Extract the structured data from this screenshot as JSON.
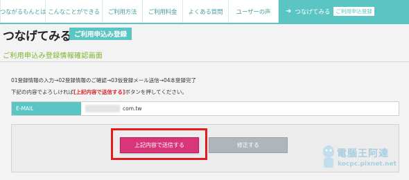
{
  "nav": {
    "items": [
      {
        "label": "つながるもんとは"
      },
      {
        "label": "こんなことができる"
      },
      {
        "label": "ご利用方法"
      },
      {
        "label": "ご利用料金"
      },
      {
        "label": "よくある質問"
      },
      {
        "label": "ユーザーの声"
      }
    ],
    "active": {
      "label": "つなげてみる",
      "badge": "ご利用申込登録"
    }
  },
  "page": {
    "title": "つなげてみる",
    "badge": "ご利用申込み登録",
    "subtitle": "ご利用申込み登録情報確認画面",
    "steps": "01登録情報の入力→02登録情報のご確認→03仮登録メール送信→04本登録完了",
    "instruction_before": "下記の内容でよろしければ",
    "instruction_highlight": "[上記内容で送信する]",
    "instruction_after": "ボタンを押してください。"
  },
  "form": {
    "email_label": "E-MAIL",
    "email_value": "com.tw"
  },
  "buttons": {
    "submit": "上記内容で送信する",
    "edit": "修正する"
  },
  "watermark": {
    "text": "電腦王阿達",
    "url": "kocpc.pixnet.net"
  }
}
